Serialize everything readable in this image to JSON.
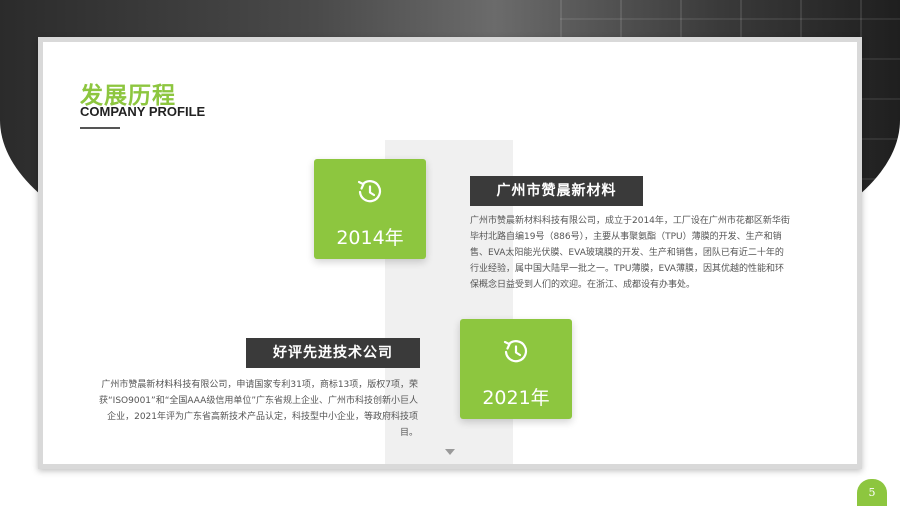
{
  "header": {
    "title_cn": "发展历程",
    "title_en": "COMPANY PROFILE"
  },
  "colors": {
    "accent": "#8dc63f",
    "label_bar": "#3a3a3a",
    "text": "#555555"
  },
  "timeline": [
    {
      "year": "2014年",
      "icon": "clock-history-icon",
      "heading": "广州市赞晨新材料",
      "description": "广州市赞晨新材料科技有限公司，成立于2014年，工厂设在广州市花都区新华街毕村北路自编19号（886号），主要从事聚氨酯（TPU）薄膜的开发、生产和销售、EVA太阳能光伏膜、EVA玻璃膜的开发、生产和销售，团队已有近二十年的行业经验，属中国大陆早一批之一。TPU薄膜，EVA薄膜，因其优越的性能和环保概念日益受到人们的欢迎。在浙江、成都设有办事处。"
    },
    {
      "year": "2021年",
      "icon": "clock-history-icon",
      "heading": "好评先进技术公司",
      "description": "广州市赞晨新材料科技有限公司，申请国家专利31项，商标13项，版权7项，荣获“ISO9001”和“全国AAA级信用单位”广东省规上企业、广州市科技创新小巨人企业，2021年评为广东省高新技术产品认定，科技型中小企业，等政府科技项目。"
    }
  ],
  "footer": {
    "page_number": "5"
  }
}
